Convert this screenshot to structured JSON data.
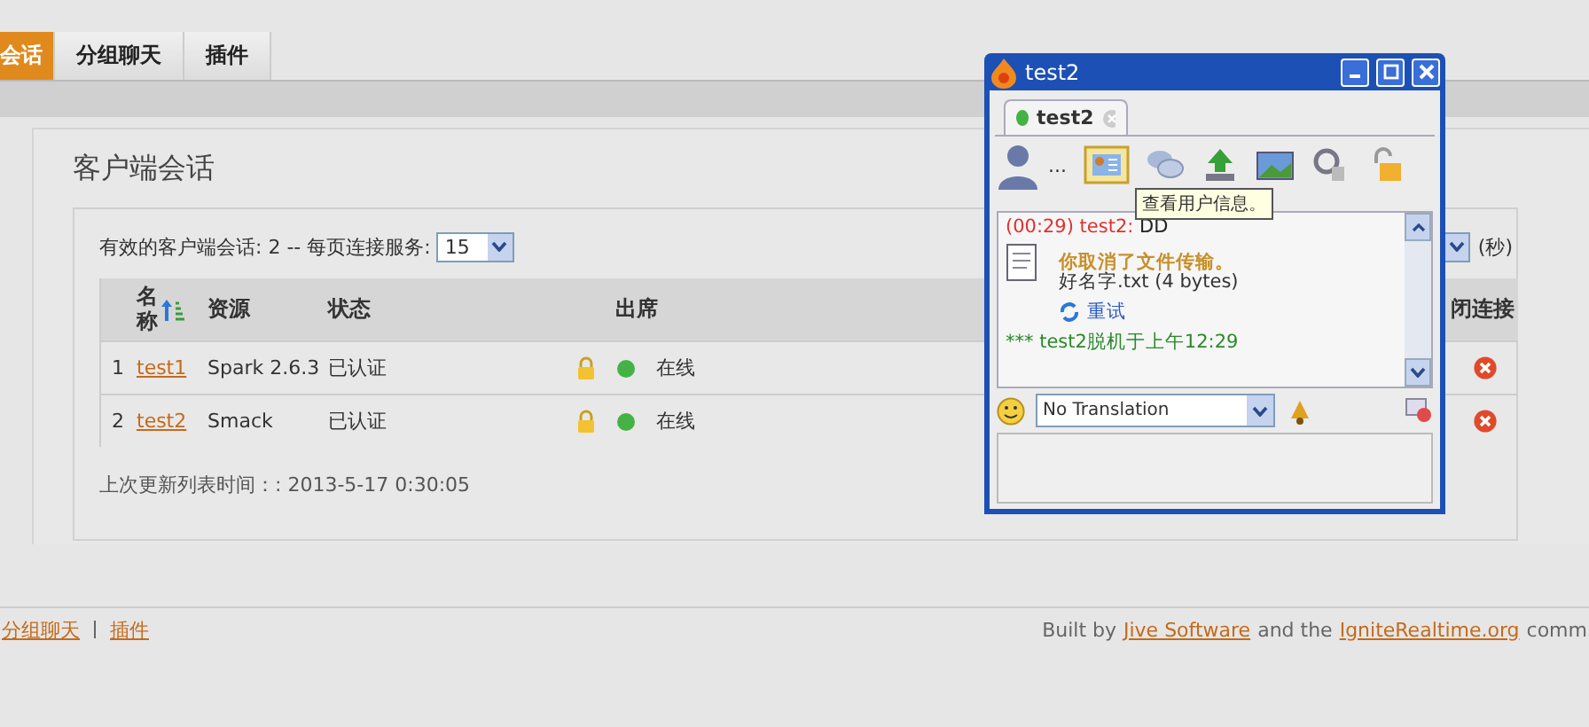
{
  "nav_tabs": [
    {
      "label": "会话",
      "selected": true
    },
    {
      "label": "分组聊天",
      "selected": false
    },
    {
      "label": "插件",
      "selected": false
    }
  ],
  "page_title": "客户端会话",
  "summary": "有效的客户端会话: 2 -- 每页连接服务:",
  "per_page": "15",
  "refresh_unit": "(秒)",
  "table": {
    "columns": [
      "名称",
      "资源",
      "状态",
      "出席",
      "闭连接"
    ],
    "rows": [
      {
        "index": "1",
        "name": "test1",
        "resource": "Spark 2.6.3",
        "status": "已认证",
        "presence": "在线",
        "online": true
      },
      {
        "index": "2",
        "name": "test2",
        "resource": "Smack",
        "status": "已认证",
        "presence": "在线",
        "online": true
      }
    ]
  },
  "last_updated": "上次更新列表时间：: 2013-5-17 0:30:05",
  "footer": {
    "links": [
      "分组聊天",
      "插件"
    ],
    "credit": [
      {
        "kind": "text",
        "text": "Built by"
      },
      {
        "kind": "link",
        "text": "Jive Software"
      },
      {
        "kind": "text",
        "text": "and the"
      },
      {
        "kind": "link",
        "text": "IgniteRealtime.org"
      },
      {
        "kind": "text",
        "text": "comm"
      }
    ]
  },
  "chat_window": {
    "title": "test2",
    "tab": {
      "label": "test2",
      "selected": true,
      "online": true
    },
    "toolbar_more": "...",
    "tooltip": "查看用户信息。",
    "messages": [
      {
        "kind": "message",
        "time": "(00:29)",
        "sender": "test2:",
        "text": "DD"
      },
      {
        "kind": "notice",
        "text": "你取消了文件传输。"
      },
      {
        "kind": "file",
        "text": "好名字.txt (4 bytes)"
      },
      {
        "kind": "retry",
        "text": "重试"
      },
      {
        "kind": "status",
        "text": "*** test2脱机于上午12:29"
      }
    ],
    "translation": "No Translation"
  }
}
